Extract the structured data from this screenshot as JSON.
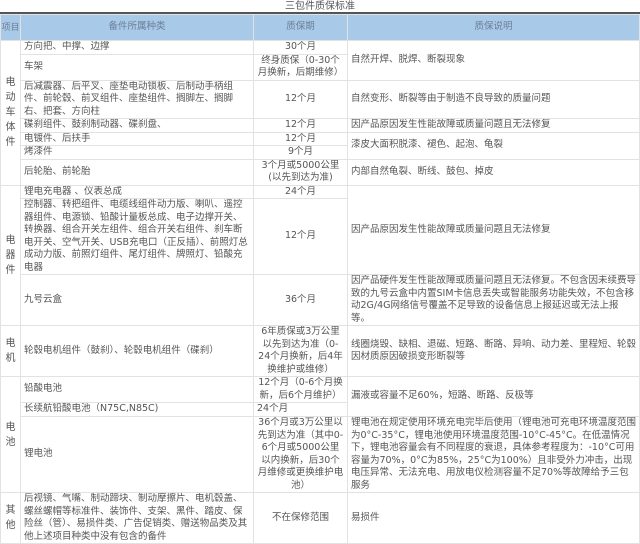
{
  "title": "三包件质保标准",
  "headers": {
    "item": "项目",
    "category": "备件所属种类",
    "period": "质保期",
    "description": "质保说明"
  },
  "groups": {
    "body": "电动车体件",
    "electric": "电器件",
    "motor": "电机",
    "battery": "电池",
    "other": "其他"
  },
  "rows": [
    {
      "category": "方向把、中撑、边撑",
      "period": "30个月",
      "description": "自然开焊、脱焊、断裂现象"
    },
    {
      "category": "车架",
      "period": "终身质保（0-30个月换新，后期维修）"
    },
    {
      "category": "后减震器、后平叉、座垫电动锁板、后制动手柄组件、前轮毂、前叉组件、座垫组件、搁脚左、搁脚右、把套、方向柱",
      "period": "12个月",
      "description": "自然变形、断裂等由于制造不良导致的质量问题"
    },
    {
      "category": "碟刹组件、鼓刹制动器、碟刹盘、",
      "period": "12个月",
      "description": "因产品原因发生性能故障或质量问题且无法修复"
    },
    {
      "category": "电镀件、后扶手",
      "period": "12个月",
      "description": "漆皮大面积脱漆、褪色、起泡、龟裂"
    },
    {
      "category": "烤漆件",
      "period": "9个月"
    },
    {
      "category": "后轮胎、前轮胎",
      "period": "3个月或5000公里(以先到达为准)",
      "description": "内部自然龟裂、断线、鼓包、掉皮"
    },
    {
      "category": "锂电充电器 、仪表总成",
      "period": "24个月",
      "description": "因产品原因发生性能故障或质量问题且无法修复"
    },
    {
      "category": "控制器、转把组件、电缆线组件动力版、喇叭、遥控器组件、电源锁、铅酸计量板总成、电子边撑开关、转换器、组合开关左组件、组合开关右组件、刹车断电开关、空气开关、USB充电口（正反插）、前照灯总成动力版、前照灯组件、尾灯组件、牌照灯、铅酸充电器",
      "period": "12个月"
    },
    {
      "category": "九号云盒",
      "period": "36个月",
      "description": "因产品硬件发生性能故障或质量问题且无法修复。不包含因未续费导致的九号云盒中内置SIM卡信息丢失或智能服务功能失效，不包含移动2G/4G网络信号覆盖不足导致的设备信息上报延迟或无法上报等。"
    },
    {
      "category": "轮毂电机组件（鼓刹）、轮毂电机组件（碟刹）",
      "period": "6年质保或3万公里以先到达为准（0-24个月换新，后4年换维护或维修）",
      "description": "线圈烧毁、缺相、退磁、短路、断路、异响、动力差、里程短、轮毂因材质原因破损变形断裂等"
    },
    {
      "category": "铅酸电池",
      "period": "12个月（0-6个月换新，后6个月维护）",
      "description": "漏液或容量不足60%，短路、断路、反极等"
    },
    {
      "category": "长续航铅酸电池（N75C,N85C)",
      "period": "24个月"
    },
    {
      "category": "锂电池",
      "period": "36个月或3万公里以先到达为准（其中0-6个月或5000公里以内换新，后30个月维修或更换维护电池）",
      "description": "锂电池在规定使用环境充电完毕后使用（锂电池可充电环境温度范围为0°C-35°C，锂电池使用环境温度范围-10°C-45°C。在低温情况下，锂电池容量会有不同程度的衰退，具体参考程度为：-10°C可用容量为70%，0°C为85%，25°C为100%）且非受外力冲击，出现电压异常、无法充电、用放电仪检测容量不足70%等故障给予三包服务"
    },
    {
      "category": "后视镜、气嘴、制动蹄块、制动摩擦片、电机毂盖、螺丝螺帽等标准件、装饰件、支架、黑件、踏皮、保险丝（管）、易损件类、广告促销类、赠送物品类及其他上述项目种类中没有包含的备件",
      "period": "不在保修范围",
      "description": "易损件"
    }
  ]
}
